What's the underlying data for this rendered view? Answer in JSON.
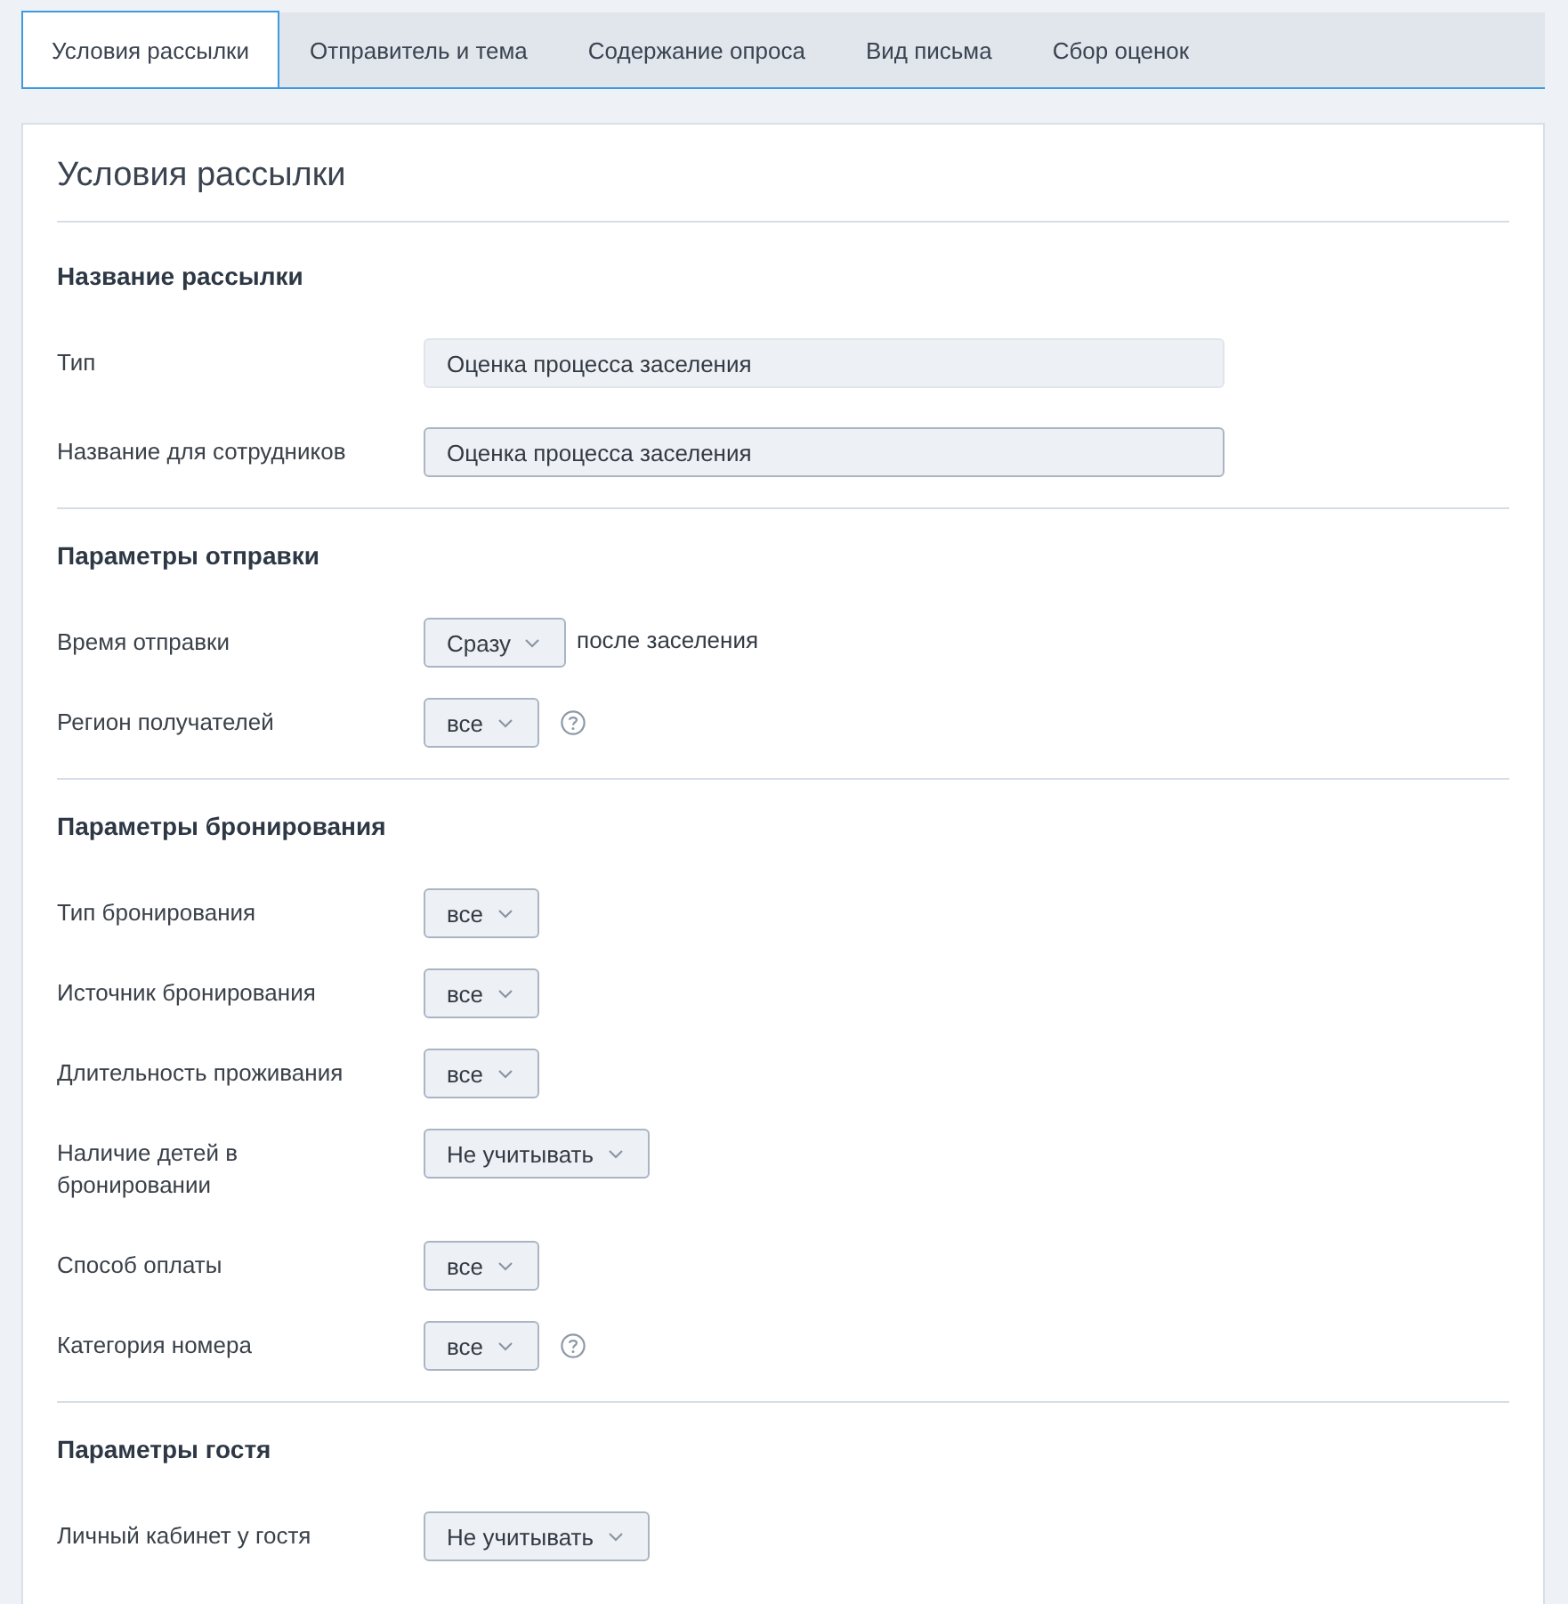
{
  "tabs": [
    {
      "label": "Условия рассылки",
      "selected": true
    },
    {
      "label": "Отправитель и тема",
      "selected": false
    },
    {
      "label": "Содержание опроса",
      "selected": false
    },
    {
      "label": "Вид письма",
      "selected": false
    },
    {
      "label": "Сбор оценок",
      "selected": false
    }
  ],
  "panel": {
    "title": "Условия рассылки",
    "sections": [
      {
        "heading": "Название рассылки",
        "rows": [
          {
            "kind": "text",
            "label": "Тип",
            "value": "Оценка процесса заселения",
            "disabled": true
          },
          {
            "kind": "text",
            "label": "Название для сотрудников",
            "value": "Оценка процесса заселения",
            "disabled": false
          }
        ]
      },
      {
        "heading": "Параметры отправки",
        "rows": [
          {
            "kind": "select",
            "label": "Время отправки",
            "value": "Сразу",
            "suffix": "после заселения",
            "help": false
          },
          {
            "kind": "select",
            "label": "Регион получателей",
            "value": "все",
            "help": true
          }
        ]
      },
      {
        "heading": "Параметры бронирования",
        "rows": [
          {
            "kind": "select",
            "label": "Тип бронирования",
            "value": "все",
            "help": false
          },
          {
            "kind": "select",
            "label": "Источник бронирования",
            "value": "все",
            "help": false
          },
          {
            "kind": "select",
            "label": "Длительность проживания",
            "value": "все",
            "help": false
          },
          {
            "kind": "select",
            "label": "Наличие детей в бронировании",
            "value": "Не учитывать",
            "help": false
          },
          {
            "kind": "select",
            "label": "Способ оплаты",
            "value": "все",
            "help": false
          },
          {
            "kind": "select",
            "label": "Категория номера",
            "value": "все",
            "help": true
          }
        ]
      },
      {
        "heading": "Параметры гостя",
        "rows": [
          {
            "kind": "select",
            "label": "Личный кабинет у гостя",
            "value": "Не учитывать",
            "help": false
          }
        ]
      }
    ]
  }
}
